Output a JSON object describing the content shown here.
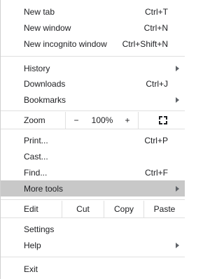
{
  "menu": {
    "new_tab": {
      "label": "New tab",
      "shortcut": "Ctrl+T"
    },
    "new_window": {
      "label": "New window",
      "shortcut": "Ctrl+N"
    },
    "new_incognito": {
      "label": "New incognito window",
      "shortcut": "Ctrl+Shift+N"
    },
    "history": {
      "label": "History"
    },
    "downloads": {
      "label": "Downloads",
      "shortcut": "Ctrl+J"
    },
    "bookmarks": {
      "label": "Bookmarks"
    },
    "zoom": {
      "label": "Zoom",
      "minus": "−",
      "value": "100%",
      "plus": "+"
    },
    "print": {
      "label": "Print...",
      "shortcut": "Ctrl+P"
    },
    "cast": {
      "label": "Cast..."
    },
    "find": {
      "label": "Find...",
      "shortcut": "Ctrl+F"
    },
    "more_tools": {
      "label": "More tools"
    },
    "edit": {
      "label": "Edit",
      "cut": "Cut",
      "copy": "Copy",
      "paste": "Paste"
    },
    "settings": {
      "label": "Settings"
    },
    "help": {
      "label": "Help"
    },
    "exit": {
      "label": "Exit"
    }
  },
  "colors": {
    "highlight": "#c8c8c8",
    "separator": "#e0e0e0",
    "text": "#202124"
  },
  "icons": {
    "submenu": "chevron-right-icon",
    "fullscreen": "fullscreen-icon"
  }
}
